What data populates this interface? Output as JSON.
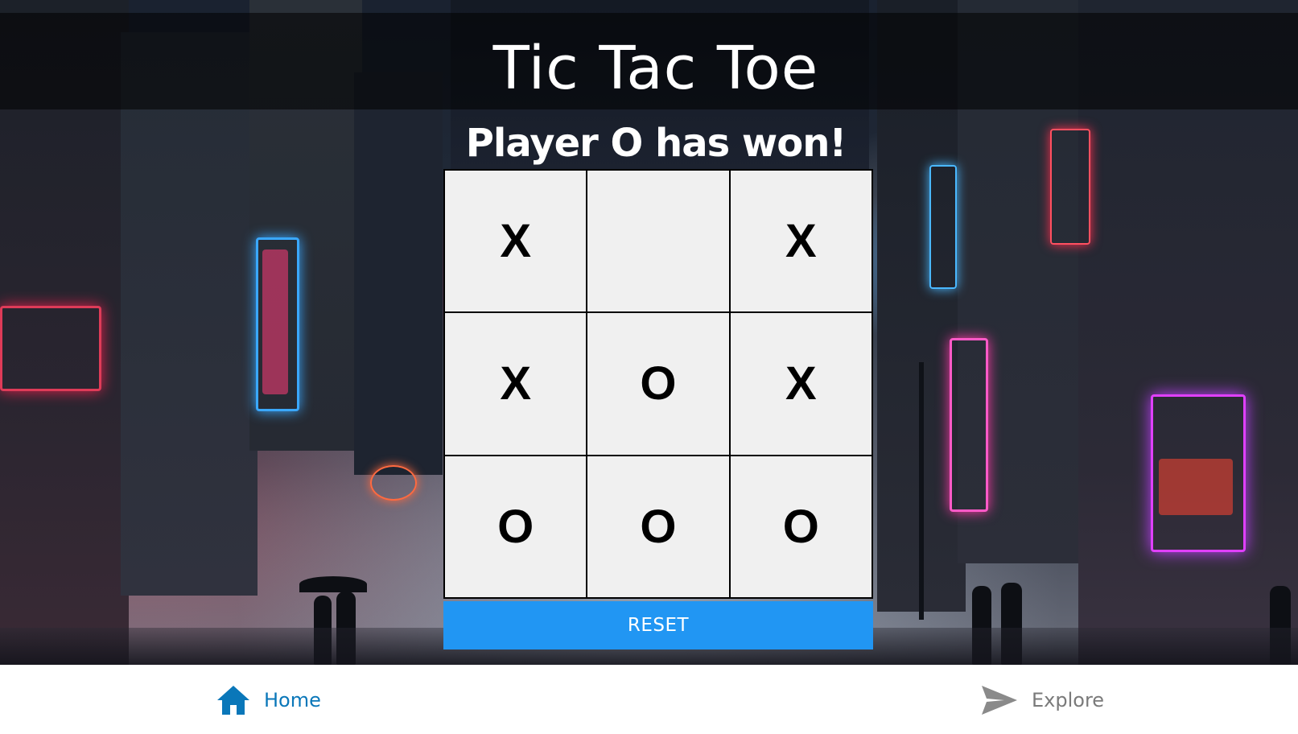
{
  "app": {
    "title": "Tic Tac Toe",
    "status": "Player O has won!"
  },
  "board": {
    "cells": [
      "X",
      "",
      "X",
      "X",
      "O",
      "X",
      "O",
      "O",
      "O"
    ]
  },
  "controls": {
    "reset_label": "RESET",
    "reset_color": "#2196f3"
  },
  "nav": {
    "home_label": "Home",
    "home_icon": "home-icon",
    "home_color": "#0a77b9",
    "explore_label": "Explore",
    "explore_icon": "send-icon",
    "explore_color": "#7a7a7a"
  },
  "background": {
    "description_icon": "cyberpunk-city-background"
  }
}
